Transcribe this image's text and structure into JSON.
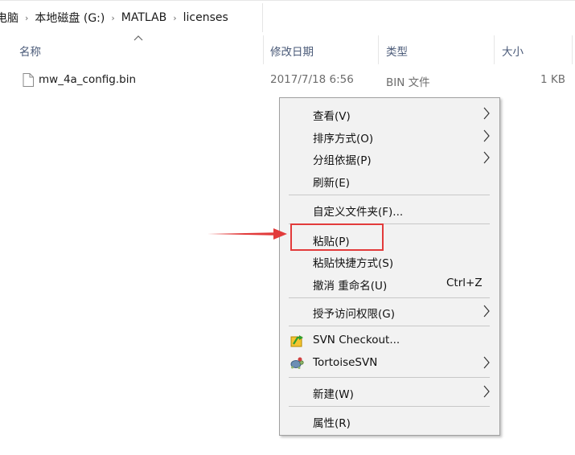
{
  "breadcrumb": {
    "items": [
      "电脑",
      "本地磁盘 (G:)",
      "MATLAB",
      "licenses"
    ],
    "separator": "›"
  },
  "columns": {
    "name": "名称",
    "date": "修改日期",
    "type": "类型",
    "size": "大小"
  },
  "files": [
    {
      "name": "mw_4a_config.bin",
      "date": "2017/7/18 6:56",
      "type": "BIN 文件",
      "size": "1 KB"
    }
  ],
  "context_menu": {
    "view": "查看(V)",
    "sort": "排序方式(O)",
    "group": "分组依据(P)",
    "refresh": "刷新(E)",
    "customize": "自定义文件夹(F)...",
    "paste": "粘贴(P)",
    "paste_shortcut": "粘贴快捷方式(S)",
    "undo_rename": "撤消 重命名(U)",
    "undo_shortcut": "Ctrl+Z",
    "grant_access": "授予访问权限(G)",
    "svn_checkout": "SVN Checkout...",
    "tortoise_svn": "TortoiseSVN",
    "new": "新建(W)",
    "properties": "属性(R)"
  },
  "colors": {
    "highlight": "#e23b3b",
    "header_text": "#4a5a78",
    "menu_bg": "#f2f2f2"
  }
}
